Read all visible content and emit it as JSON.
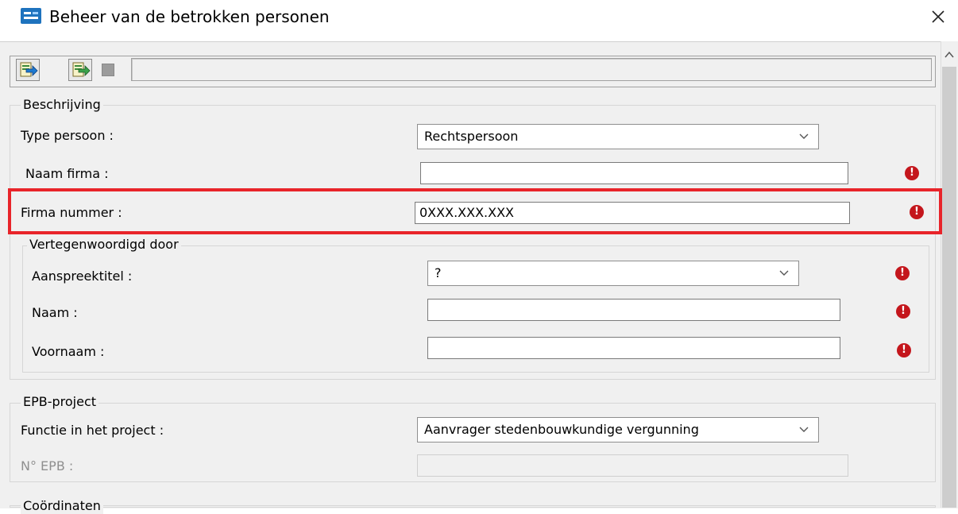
{
  "window": {
    "title": "Beheer van de betrokken personen",
    "icon": "app-window-icon",
    "close_glyph": "×"
  },
  "toolbar": {
    "buttons": [
      {
        "icon": "import-arrow-icon"
      },
      {
        "icon": "export-arrow-icon"
      },
      {
        "icon": "disabled-square-icon"
      }
    ],
    "field_value": ""
  },
  "beschrijving": {
    "legend": "Beschrijving",
    "type_persoon": {
      "label": "Type persoon :",
      "value": "Rechtspersoon"
    },
    "naam_firma": {
      "label": "Naam firma :",
      "value": ""
    },
    "firma_nummer": {
      "label": "Firma nummer :",
      "value": "0XXX.XXX.XXX"
    }
  },
  "vertegenwoordigd": {
    "legend": "Vertegenwoordigd door",
    "aanspreektitel": {
      "label": "Aanspreektitel :",
      "value": "?"
    },
    "naam": {
      "label": "Naam :",
      "value": ""
    },
    "voornaam": {
      "label": "Voornaam :",
      "value": ""
    }
  },
  "epb_project": {
    "legend": "EPB-project",
    "functie": {
      "label": "Functie in het project :",
      "value": "Aanvrager stedenbouwkundige vergunning"
    },
    "nr_epb": {
      "label": "N° EPB :",
      "value": ""
    }
  },
  "coordinaten": {
    "legend": "Coördinaten"
  },
  "error_marker_glyph": "!",
  "colors": {
    "error": "#c4161c",
    "highlight": "#e8242a",
    "dialog_bg": "#f0f0f0",
    "app_icon": "#1e73be"
  }
}
